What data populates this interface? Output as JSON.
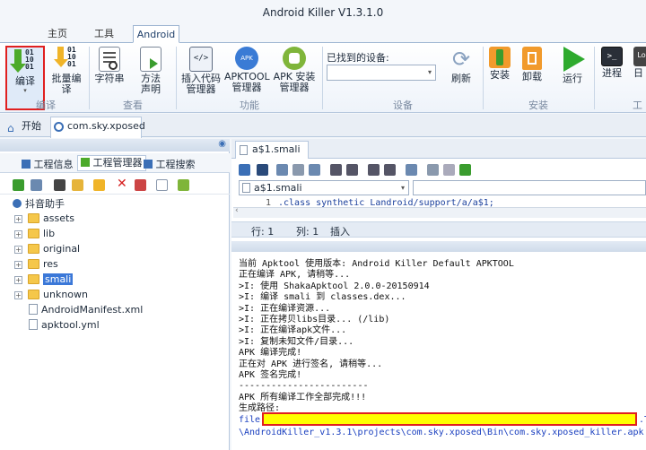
{
  "window": {
    "title": "Android Killer V1.3.1.0"
  },
  "menu_tabs": [
    {
      "label": "主页"
    },
    {
      "label": "工具"
    },
    {
      "label": "Android"
    }
  ],
  "ribbon": {
    "groups": [
      {
        "label": "编译"
      },
      {
        "label": "查看"
      },
      {
        "label": "功能"
      },
      {
        "label": "设备"
      },
      {
        "label": "安装"
      },
      {
        "label": "工"
      }
    ],
    "buttons": {
      "compile": "编译",
      "batch_compile": "批量编译",
      "strings": "字符串",
      "method_declare": "方法声明",
      "insert_code": "插入代码管理器",
      "apktool": "APKTOOL管理器",
      "apk_install": "APK 安装管理器",
      "refresh": "刷新",
      "install": "安装",
      "uninstall": "卸载",
      "run": "运行",
      "process": "进程",
      "log": "日"
    },
    "device_label": "已找到的设备:",
    "device_value": ""
  },
  "doc_tabs": [
    {
      "label": "开始"
    },
    {
      "label": "com.sky.xposed"
    }
  ],
  "left_panel": {
    "subtabs": [
      "工程信息",
      "工程管理器",
      "工程搜索"
    ],
    "root": "抖音助手",
    "items": [
      {
        "name": "assets",
        "type": "folder"
      },
      {
        "name": "lib",
        "type": "folder"
      },
      {
        "name": "original",
        "type": "folder"
      },
      {
        "name": "res",
        "type": "folder"
      },
      {
        "name": "smali",
        "type": "folder",
        "selected": true
      },
      {
        "name": "unknown",
        "type": "folder"
      },
      {
        "name": "AndroidManifest.xml",
        "type": "file"
      },
      {
        "name": "apktool.yml",
        "type": "file"
      }
    ]
  },
  "editor": {
    "tab": "a$1.smali",
    "file_select": "a$1.smali",
    "line_no": "1",
    "code": ".class synthetic Landroid/support/a/a$1;",
    "status": {
      "row": "行: 1",
      "col": "列: 1",
      "mode": "插入"
    }
  },
  "log_lines": [
    "当前 Apktool 使用版本: Android Killer Default APKTOOL",
    "正在编译 APK, 请稍等...",
    ">I: 使用 ShakaApktool 2.0.0-20150914",
    ">I: 编译 smali 到 classes.dex...",
    ">I: 正在编译资源...",
    ">I: 正在拷贝libs目录... (/lib)",
    ">I: 正在编译apk文件...",
    ">I: 复制未知文件/目录...",
    "APK 编译完成!",
    "正在对 APK 进行签名, 请稍等...",
    "APK 签名完成!",
    "------------------------",
    "APK 所有编译工作全部完成!!!",
    "生成路径:"
  ],
  "output_path": {
    "prefix": "file:",
    "suffix": ".T",
    "line2": "\\AndroidKiller_v1.3.1\\projects\\com.sky.xposed\\Bin\\com.sky.xposed_killer.apk"
  },
  "colors": {
    "accent": "#3b6fb6",
    "highlight": "#ffff00",
    "annotation": "#e02020"
  }
}
